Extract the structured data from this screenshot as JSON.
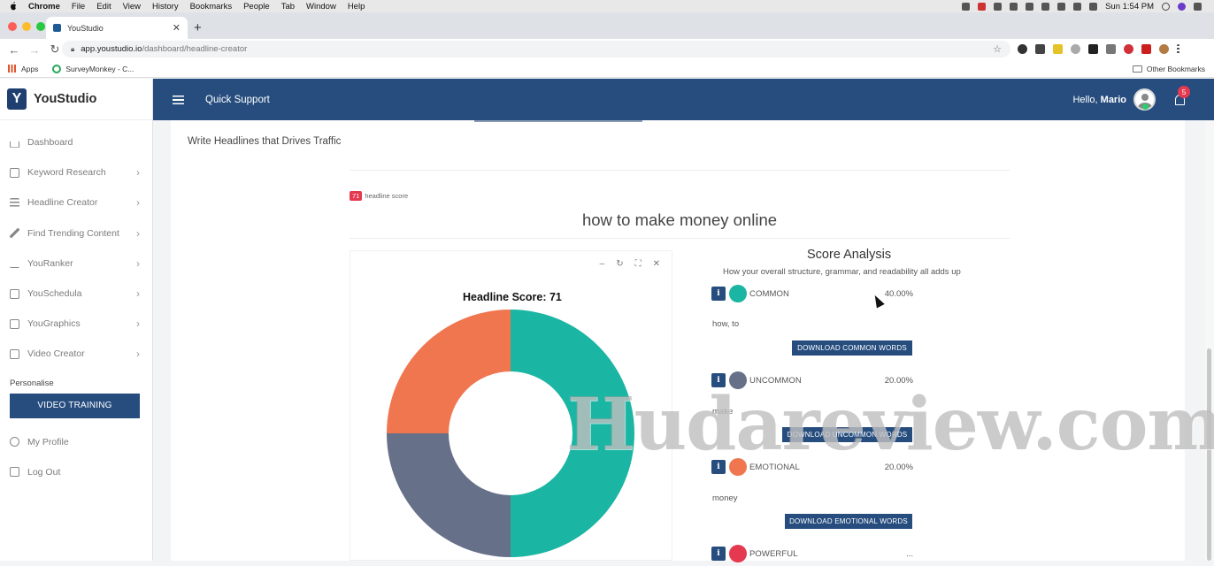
{
  "mac_menu": {
    "app": "Chrome",
    "items": [
      "File",
      "Edit",
      "View",
      "History",
      "Bookmarks",
      "People",
      "Tab",
      "Window",
      "Help"
    ],
    "clock": "Sun 1:54 PM"
  },
  "browser": {
    "tab_title": "YouStudio",
    "url_host": "app.youstudio.io",
    "url_path": "/dashboard/headline-creator",
    "bookmarks": [
      {
        "label": "Apps"
      },
      {
        "label": "SurveyMonkey - C..."
      }
    ],
    "other_bookmarks": "Other Bookmarks"
  },
  "sidebar": {
    "brand": "YouStudio",
    "items": [
      {
        "label": "Dashboard",
        "icon": "home-icon"
      },
      {
        "label": "Keyword Research",
        "icon": "checkbox-icon"
      },
      {
        "label": "Headline Creator",
        "icon": "list-icon"
      },
      {
        "label": "Find Trending Content",
        "icon": "pencil-icon"
      },
      {
        "label": "YouRanker",
        "icon": "chart-icon"
      },
      {
        "label": "YouSchedula",
        "icon": "calendar-icon"
      },
      {
        "label": "YouGraphics",
        "icon": "image-icon"
      },
      {
        "label": "Video Creator",
        "icon": "video-icon"
      }
    ],
    "personalise": "Personalise",
    "video_training": "VIDEO TRAINING",
    "my_profile": "My Profile",
    "log_out": "Log Out"
  },
  "topbar": {
    "quick_support": "Quick Support",
    "hello": "Hello,",
    "user": "Mario",
    "notifications": "5"
  },
  "page": {
    "title": "Write Headlines that Drives Traffic",
    "score_badge": "71",
    "score_badge_label": "headline score",
    "headline": "how to make money online"
  },
  "chart_data": {
    "type": "pie",
    "title": "Headline Score: 71",
    "categories": [
      "COMMON",
      "UNCOMMON",
      "EMOTIONAL"
    ],
    "values": [
      40,
      20,
      20
    ],
    "colors": [
      "#1ab5a3",
      "#667089",
      "#f07650"
    ],
    "donut": true,
    "note_visible_slices": "teal, slate and orange slices visible"
  },
  "analysis": {
    "title": "Score Analysis",
    "subtitle": "How your overall structure, grammar, and readability all adds up",
    "rows": [
      {
        "label": "COMMON",
        "pct": "40.00%",
        "color": "#1ab5a3",
        "words": "how, to",
        "button": "DOWNLOAD COMMON WORDS"
      },
      {
        "label": "UNCOMMON",
        "pct": "20.00%",
        "color": "#667089",
        "words": "make",
        "button": "DOWNLOAD UNCOMMON WORDS"
      },
      {
        "label": "EMOTIONAL",
        "pct": "20.00%",
        "color": "#f07650",
        "words": "money",
        "button": "DOWNLOAD EMOTIONAL WORDS"
      },
      {
        "label": "POWERFUL",
        "pct": "...",
        "color": "#e53950"
      }
    ]
  },
  "watermark": "Hudareview.com"
}
